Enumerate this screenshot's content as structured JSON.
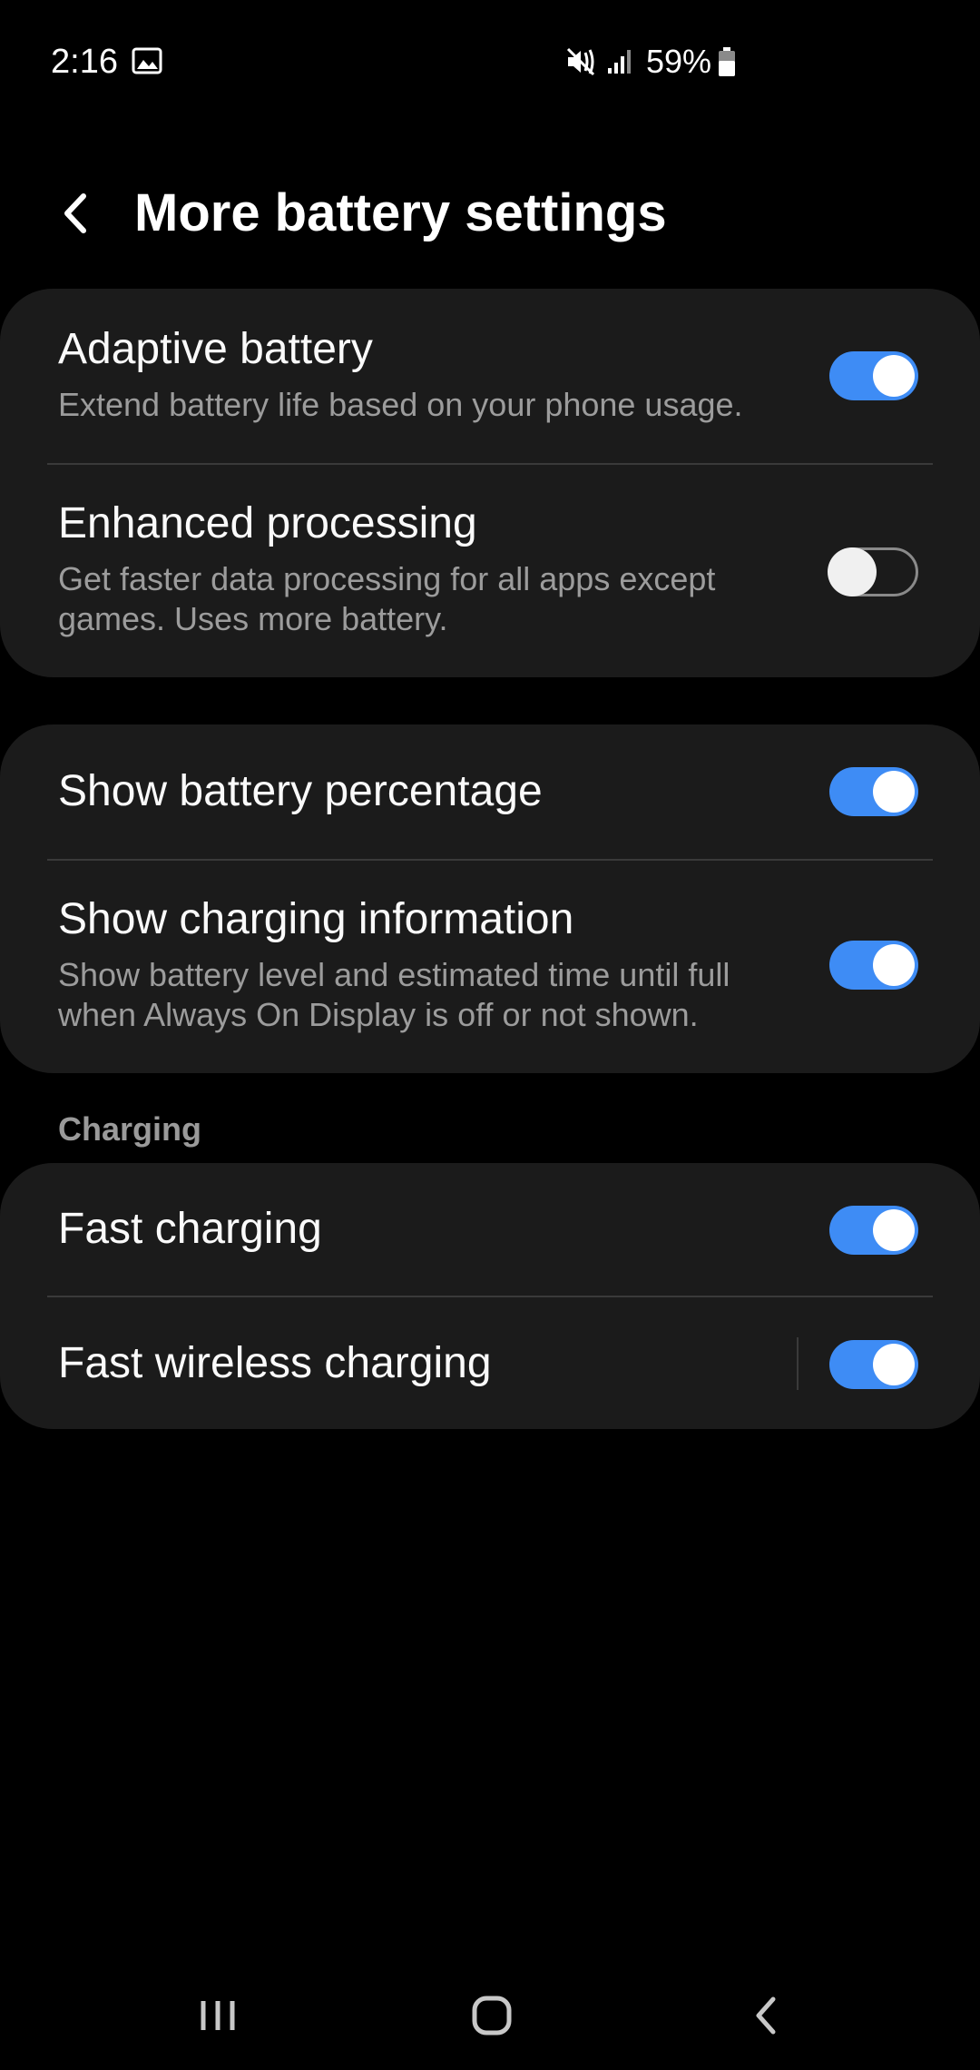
{
  "status_bar": {
    "time": "2:16",
    "battery_percent": "59%",
    "icons": [
      "gallery-icon",
      "mute-icon",
      "signal-icon",
      "battery-icon"
    ]
  },
  "header": {
    "title": "More battery settings",
    "back_icon": "back-arrow-icon"
  },
  "groups": [
    {
      "items": [
        {
          "title": "Adaptive battery",
          "subtitle": "Extend battery life based on your phone usage.",
          "enabled": true
        },
        {
          "title": "Enhanced processing",
          "subtitle": "Get faster data processing for all apps except games. Uses more battery.",
          "enabled": false
        }
      ]
    },
    {
      "items": [
        {
          "title": "Show battery percentage",
          "enabled": true
        },
        {
          "title": "Show charging information",
          "subtitle": "Show battery level and estimated time until full when Always On Display is off or not shown.",
          "enabled": true
        }
      ]
    },
    {
      "header": "Charging",
      "items": [
        {
          "title": "Fast charging",
          "enabled": true
        },
        {
          "title": "Fast wireless charging",
          "enabled": true
        }
      ]
    }
  ],
  "nav_bar": {
    "buttons": [
      "recents-icon",
      "home-icon",
      "back-icon"
    ]
  },
  "colors": {
    "background": "#000000",
    "card": "#1b1b1b",
    "accent": "#3e8cf5",
    "subtitle": "#9c9c9c"
  }
}
